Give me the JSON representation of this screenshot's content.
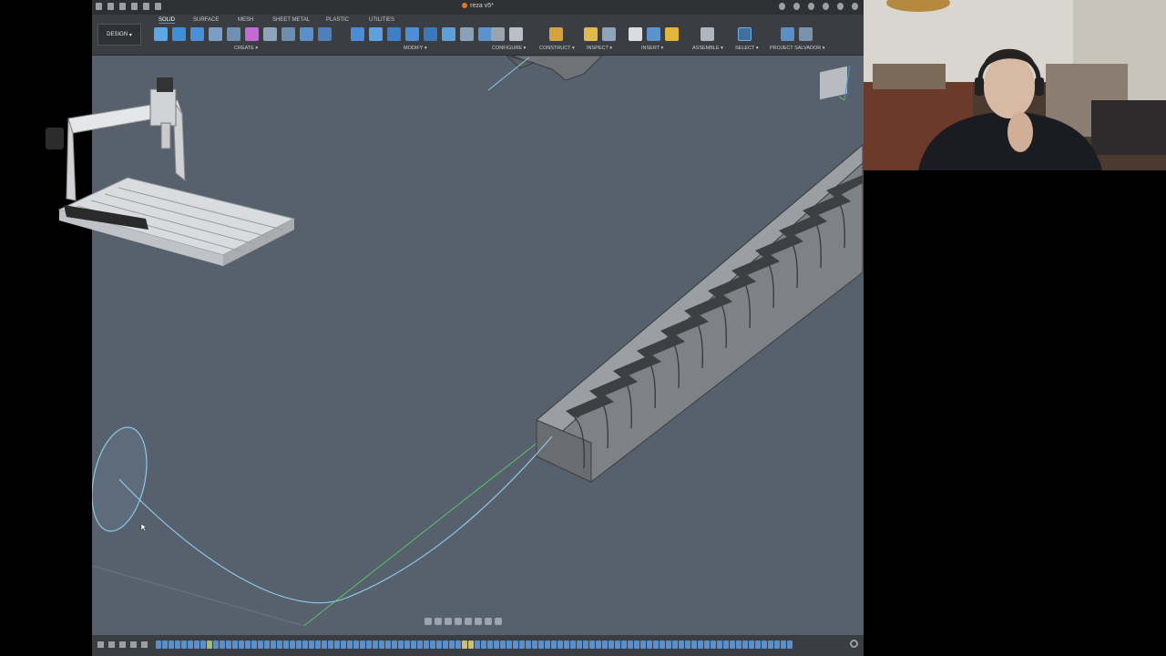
{
  "window": {
    "document_title": "reza v5*"
  },
  "toolbar": {
    "workspace_button": "DESIGN",
    "tabs": [
      {
        "label": "SOLID",
        "active": true
      },
      {
        "label": "SURFACE",
        "active": false
      },
      {
        "label": "MESH",
        "active": false
      },
      {
        "label": "SHEET METAL",
        "active": false
      },
      {
        "label": "PLASTIC",
        "active": false
      },
      {
        "label": "UTILITIES",
        "active": false
      }
    ],
    "groups": {
      "create": "CREATE",
      "modify": "MODIFY",
      "configure": "CONFIGURE",
      "construct": "CONSTRUCT",
      "inspect": "INSPECT",
      "insert": "INSERT",
      "assemble": "ASSEMBLE",
      "select": "SELECT",
      "project_salvador": "PROJECT SALVADOR"
    }
  },
  "viewport": {
    "background": "#56616d",
    "sketch_color": "#8ec8e8",
    "axis_color": "#59c26a"
  },
  "overlays": {
    "reference_image": "CNC router machine",
    "webcam": "webcam feed"
  }
}
